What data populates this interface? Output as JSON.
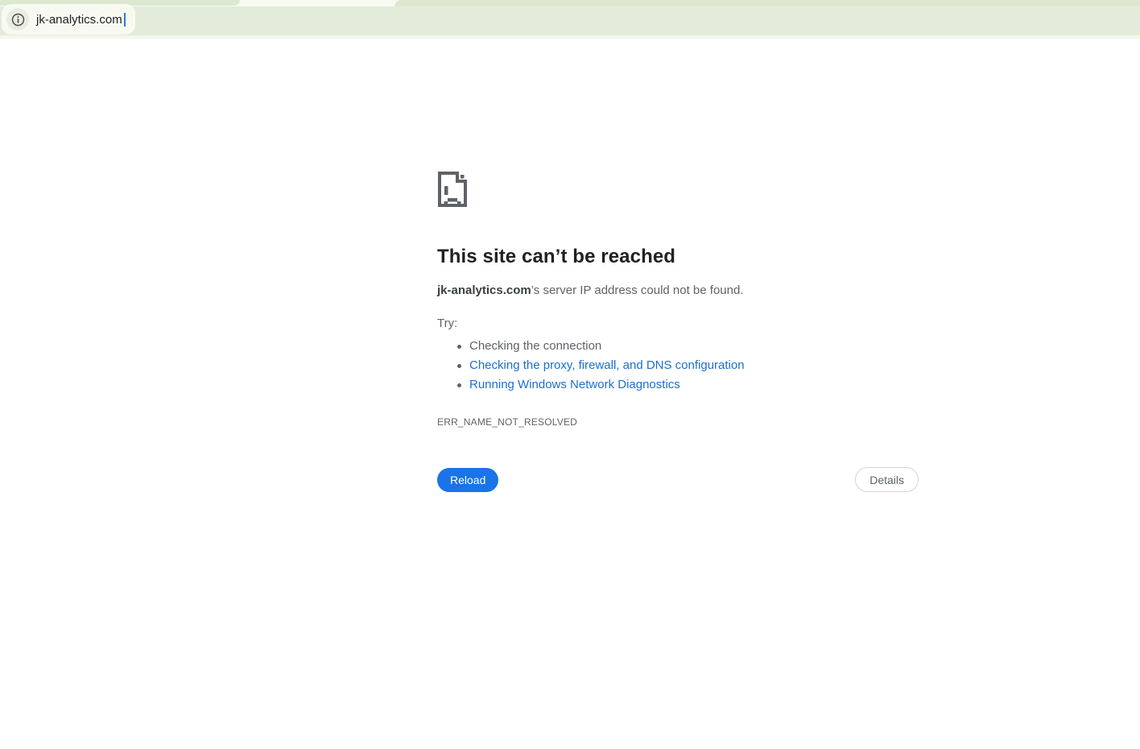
{
  "chrome": {
    "url": "jk-analytics.com"
  },
  "page": {
    "title": "This site can’t be reached",
    "message_domain": "jk-analytics.com",
    "message_rest": "’s server IP address could not be found.",
    "try_label": "Try:",
    "suggestions": [
      {
        "label": "Checking the connection",
        "is_link": false
      },
      {
        "label": "Checking the proxy, firewall, and DNS configuration",
        "is_link": true
      },
      {
        "label": "Running Windows Network Diagnostics",
        "is_link": true
      }
    ],
    "error_code": "ERR_NAME_NOT_RESOLVED",
    "buttons": {
      "reload": "Reload",
      "details": "Details"
    }
  },
  "colors": {
    "toolbar_green": "#e3ecda",
    "tab_green": "#dde8d1",
    "cream": "#f8faf2",
    "link_blue": "#1b6fce",
    "reload_blue": "#1a73e8",
    "text_dark": "#202124",
    "text_gray": "#5f6368"
  }
}
